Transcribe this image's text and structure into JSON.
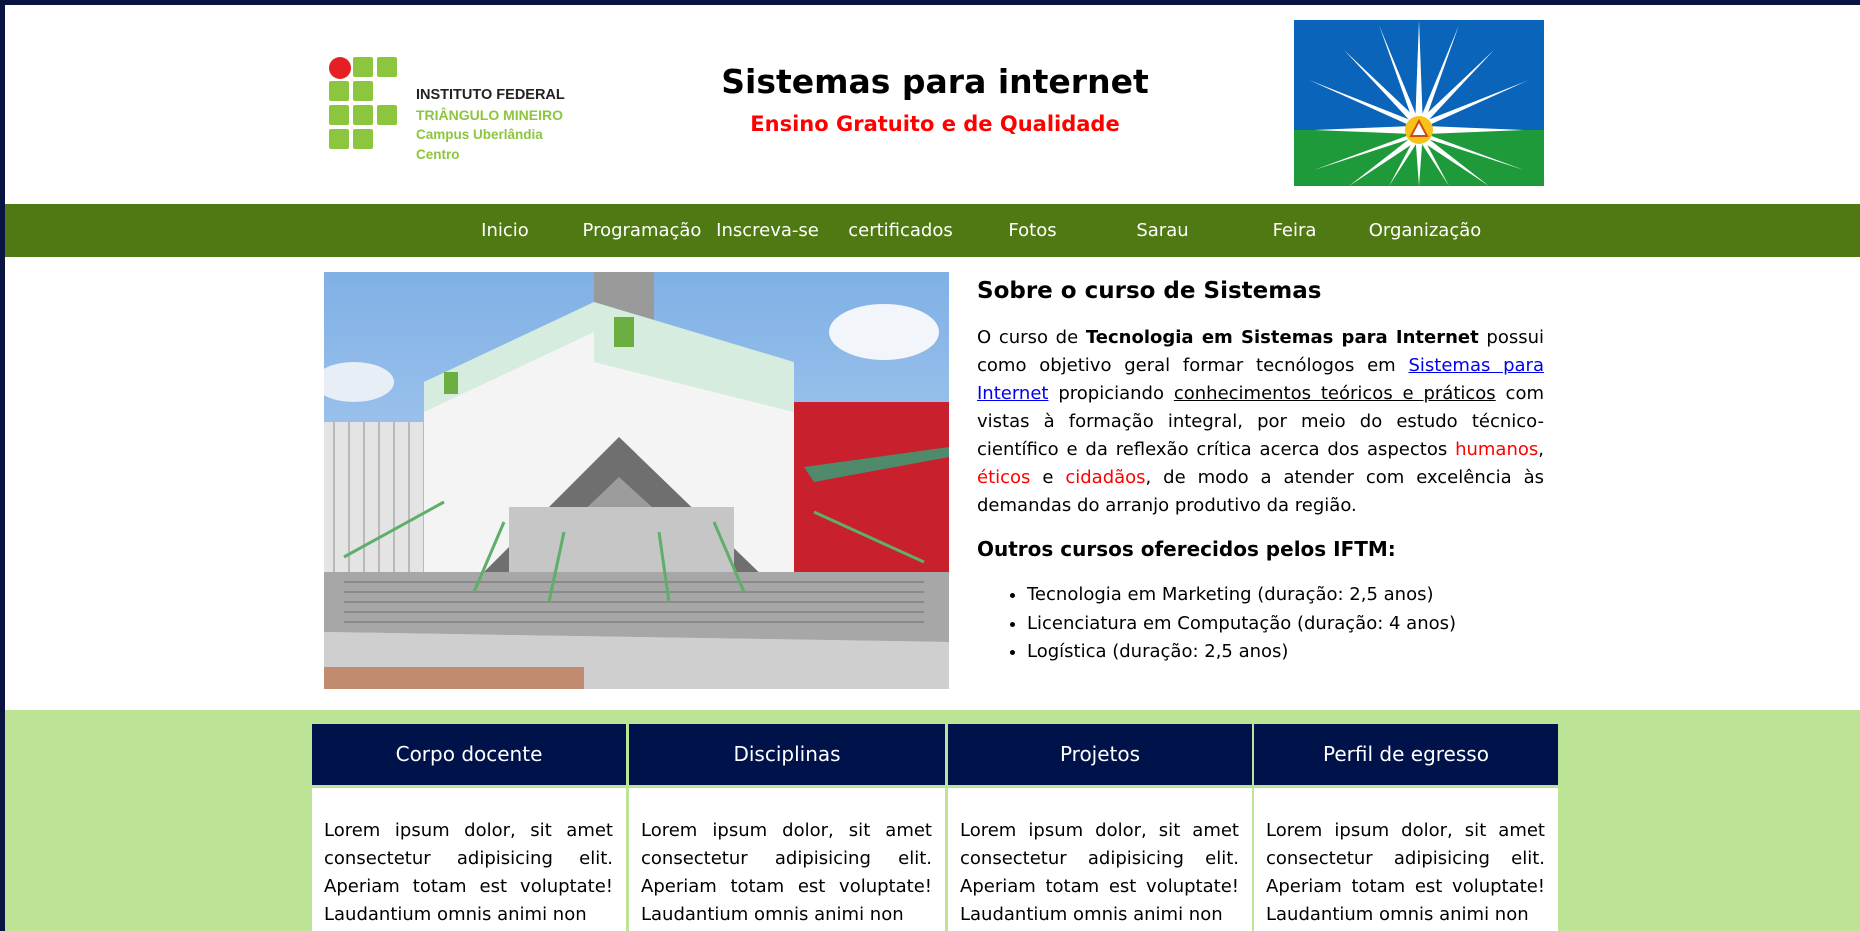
{
  "header": {
    "logo": {
      "line1": "INSTITUTO FEDERAL",
      "line2": "TRIÂNGULO MINEIRO",
      "line3": "Campus Uberlândia Centro"
    },
    "title": "Sistemas para internet",
    "subtitle": "Ensino Gratuito e de Qualidade"
  },
  "nav": {
    "items": [
      "Inicio",
      "Programação",
      "Inscreva-se",
      "certificados",
      "Fotos",
      "Sarau",
      "Feira",
      "Organização"
    ]
  },
  "about": {
    "title": "Sobre o curso de Sistemas",
    "p_start": "O curso de ",
    "p_strong": "Tecnologia em Sistemas para Internet",
    "p_mid1": " possui como objetivo geral formar tecnólogos em ",
    "p_link": "Sistemas para Internet",
    "p_mid2": " propiciando ",
    "p_underline": "conhecimentos teóricos e práticos",
    "p_mid3": " com vistas à formação integral, por meio do estudo técnico-científico e da reflexão crítica acerca dos aspectos ",
    "p_red1": "humanos",
    "p_sep1": ", ",
    "p_red2": "éticos",
    "p_sep2": " e ",
    "p_red3": "cidadãos",
    "p_end": ", de modo a atender com excelência às demandas do arranjo produtivo da região."
  },
  "others": {
    "title": "Outros cursos oferecidos pelos IFTM:",
    "courses": [
      "Tecnologia em Marketing (duração: 2,5 anos)",
      "Licenciatura em Computação (duração: 4 anos)",
      "Logística (duração: 2,5 anos)"
    ]
  },
  "cards": [
    {
      "title": "Corpo docente",
      "text": "Lorem ipsum dolor, sit amet consectetur adipisicing elit. Aperiam totam est voluptate! Laudantium omnis animi non"
    },
    {
      "title": "Disciplinas",
      "text": "Lorem ipsum dolor, sit amet consectetur adipisicing elit. Aperiam totam est voluptate! Laudantium omnis animi non"
    },
    {
      "title": "Projetos",
      "text": "Lorem ipsum dolor, sit amet consectetur adipisicing elit. Aperiam totam est voluptate! Laudantium omnis animi non"
    },
    {
      "title": "Perfil de egresso",
      "text": "Lorem ipsum dolor, sit amet consectetur adipisicing elit. Aperiam totam est voluptate! Laudantium omnis animi non"
    }
  ],
  "colors": {
    "nav_bg": "#4f7a13",
    "card_head_bg": "#00124a",
    "band_bg": "#bde396",
    "accent_red": "#ff0000",
    "logo_green": "#8cc63f"
  }
}
